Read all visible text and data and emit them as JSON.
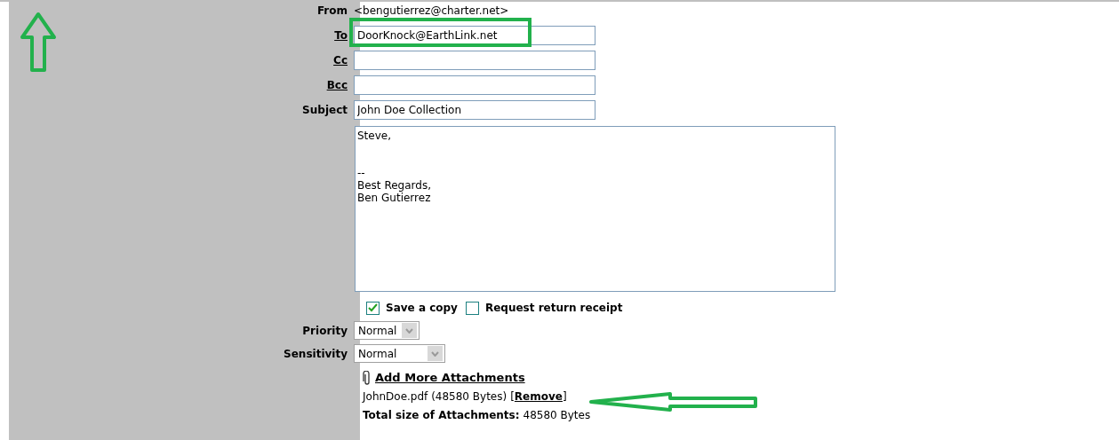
{
  "header_fields": [
    {
      "kind": "text",
      "label": "From",
      "value": "<bengutierrez@charter.net>",
      "link": false
    },
    {
      "kind": "input",
      "label": "To",
      "value": "DoorKnock@EarthLink.net",
      "link": true
    },
    {
      "kind": "input",
      "label": "Cc",
      "link": true
    },
    {
      "kind": "input",
      "label": "Bcc",
      "link": true
    },
    {
      "kind": "input",
      "label": "Subject",
      "value": "John Doe Collection",
      "link": false
    }
  ],
  "body": "Steve,\n\n\n--\nBest Regards,\nBen Gutierrez",
  "options": [
    {
      "label": "Save a copy",
      "checked": true
    },
    {
      "label": "Request return receipt",
      "checked": false
    }
  ],
  "selects": [
    {
      "label": "Priority",
      "value": "Normal",
      "wide": false
    },
    {
      "label": "Sensitivity",
      "value": "Normal",
      "wide": true
    }
  ],
  "attachments": {
    "add_link": "Add More Attachments",
    "file": "JohnDoe.pdf (48580 Bytes)",
    "remove_open": "[",
    "remove_link": "Remove",
    "remove_close": "]",
    "total_label": "Total size of Attachments:",
    "total_value": "48580 Bytes"
  }
}
